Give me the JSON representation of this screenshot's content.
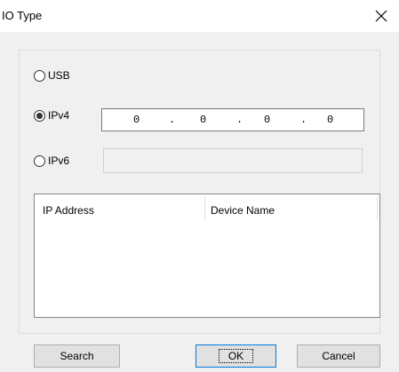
{
  "window": {
    "title": "IO Type",
    "close_icon": "close-icon"
  },
  "connection": {
    "usb_label": "USB",
    "ipv4_label": "IPv4",
    "ipv6_label": "IPv6",
    "selected": "IPv4",
    "ipv4_value": [
      "0",
      "0",
      "0",
      "0"
    ],
    "ipv4_separator": ".",
    "ipv6_value": ""
  },
  "device_list": {
    "columns": [
      "IP Address",
      "Device Name"
    ],
    "rows": []
  },
  "buttons": {
    "search": "Search",
    "ok": "OK",
    "cancel": "Cancel"
  }
}
